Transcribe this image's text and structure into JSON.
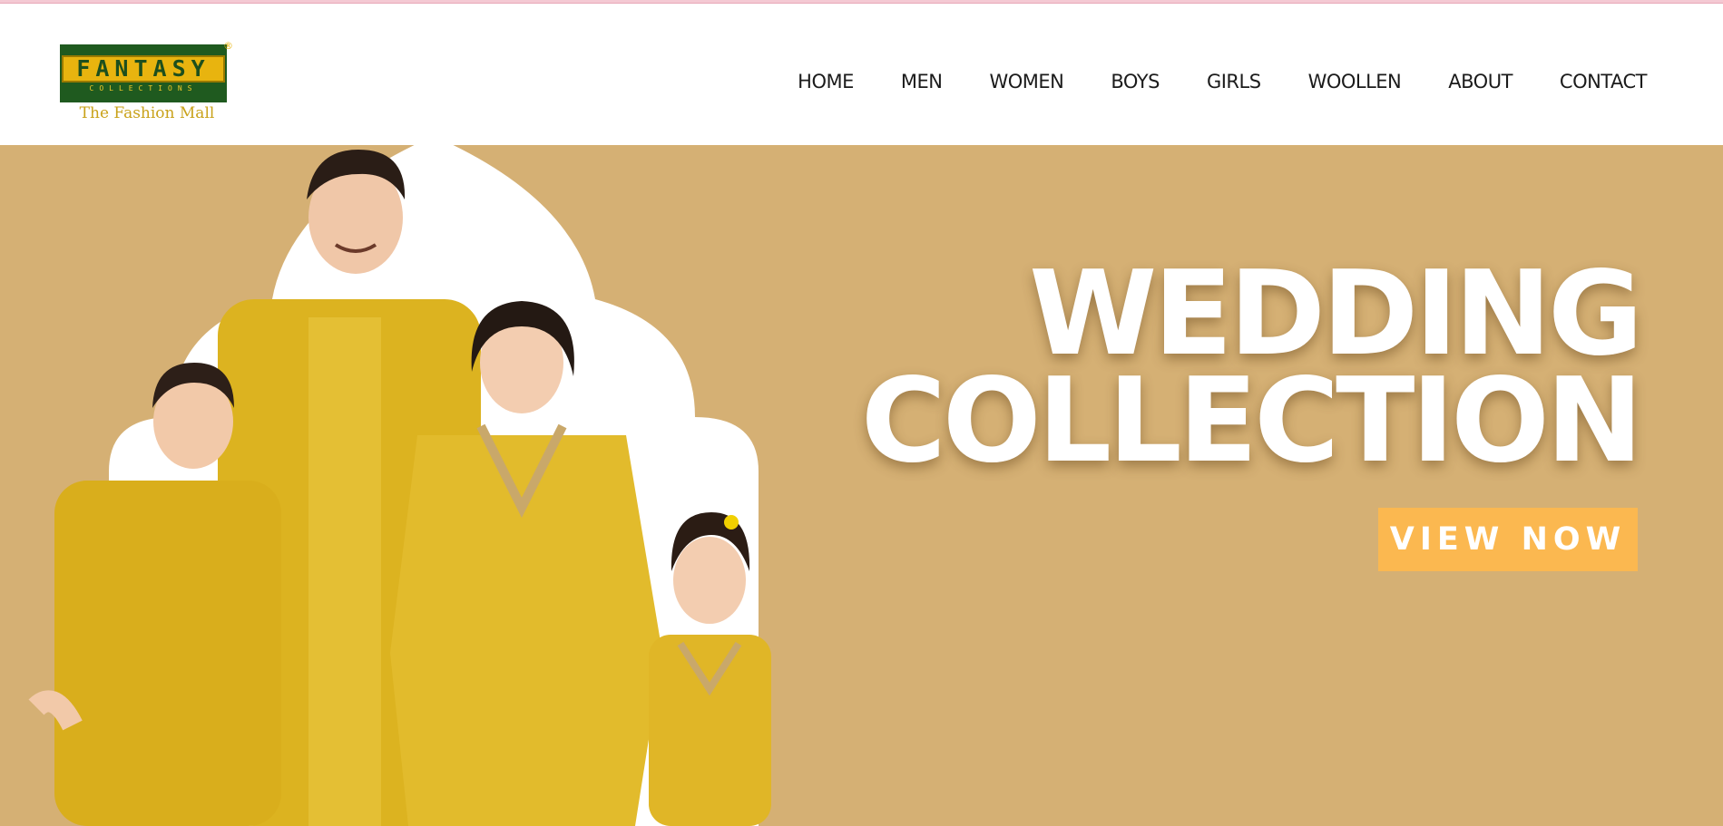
{
  "logo": {
    "wordmark": "FANTASY",
    "sub": "COLLECTIONS",
    "registered": "®",
    "tagline": "The Fashion Mall"
  },
  "nav": {
    "items": [
      {
        "label": "HOME"
      },
      {
        "label": "MEN"
      },
      {
        "label": "WOMEN"
      },
      {
        "label": "BOYS"
      },
      {
        "label": "GIRLS"
      },
      {
        "label": "WOOLLEN"
      },
      {
        "label": "ABOUT"
      },
      {
        "label": "CONTACT"
      }
    ]
  },
  "hero": {
    "title_line1": "WEDDING",
    "title_line2": "COLLECTION",
    "cta_label": "VIEW NOW",
    "image_alt": "family-in-yellow-wedding-outfits"
  },
  "colors": {
    "hero_bg": "#d5b074",
    "cta_bg": "#fbb850",
    "logo_green": "#1f5a1f",
    "logo_gold": "#e8b40f",
    "outfit_yellow": "#dcb320"
  }
}
